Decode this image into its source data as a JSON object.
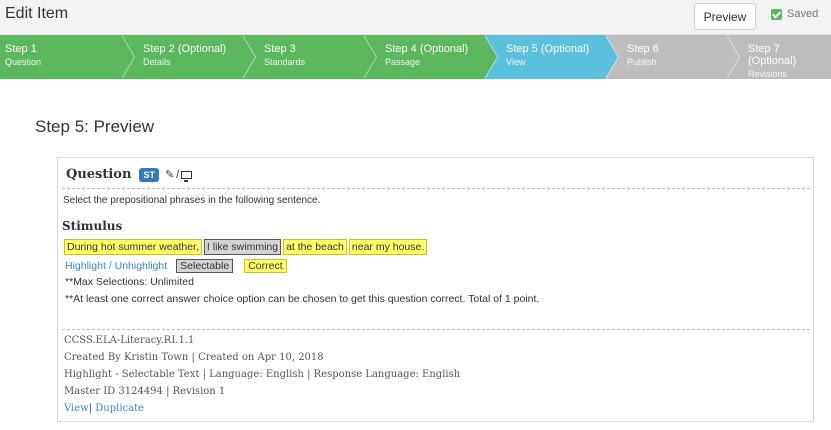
{
  "header": {
    "title": "Edit Item",
    "preview_label": "Preview",
    "saved_label": "Saved"
  },
  "steps": [
    {
      "num": "Step 1",
      "sub": "Question",
      "state": "done"
    },
    {
      "num": "Step 2  (Optional)",
      "sub": "Details",
      "state": "done"
    },
    {
      "num": "Step 3",
      "sub": "Standards",
      "state": "done"
    },
    {
      "num": "Step 4  (Optional)",
      "sub": "Passage",
      "state": "done"
    },
    {
      "num": "Step 5  (Optional)",
      "sub": "View",
      "state": "active"
    },
    {
      "num": "Step 6",
      "sub": "Publish",
      "state": "todo"
    },
    {
      "num": "Step 7  (Optional)",
      "sub": "Revisions",
      "state": "todo"
    }
  ],
  "page_heading": "Step 5: Preview",
  "question": {
    "title": "Question",
    "badge": "ST",
    "slash": "/",
    "prompt": "Select the prepositional phrases in the following sentence.",
    "stimulus_heading": "Stimulus",
    "choices": [
      {
        "text": "During hot summer weather,",
        "kind": "correct"
      },
      {
        "text": "I like swimming",
        "kind": "selectable"
      },
      {
        "text": "at the beach",
        "kind": "correct"
      },
      {
        "text": "near my house.",
        "kind": "correct"
      }
    ],
    "legend": {
      "highlight_link": "Highlight / Unhighlight",
      "selectable": "Selectable",
      "correct": "Correct"
    },
    "note_max": "**Max Selections: Unlimited",
    "note_points": "**At least one correct answer choice option can be chosen to get this question correct. Total of 1 point."
  },
  "meta": {
    "standard": "CCSS.ELA-Literacy.RI.1.1",
    "created": "Created By Kristin Town | Created on Apr 10, 2018",
    "type_line": "Highlight - Selectable Text | Language: English | Response Language: English",
    "master": "Master ID 3124494 | Revision 1",
    "view_link": "View",
    "sep": "|",
    "duplicate_link": "Duplicate"
  }
}
